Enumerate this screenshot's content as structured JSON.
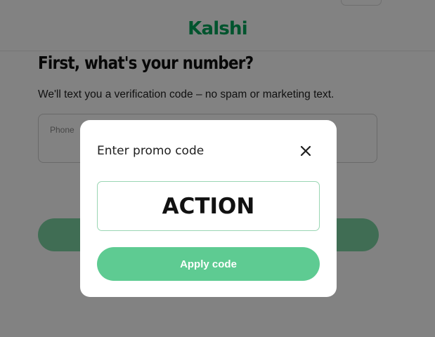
{
  "page": {
    "brand": "Kalshi",
    "headline": "First, what's your number?",
    "subtext": "We'll text you a verification code – no spam or marketing text.",
    "phone_placeholder": "Phone"
  },
  "modal": {
    "title": "Enter promo code",
    "close_icon": "close-icon",
    "promo_value": "ACTION",
    "apply_label": "Apply code"
  },
  "colors": {
    "brand_green": "#00a55a",
    "button_green": "#5ecb92",
    "input_border": "#9ad6b3",
    "overlay": "rgba(0,0,0,0.49)"
  }
}
